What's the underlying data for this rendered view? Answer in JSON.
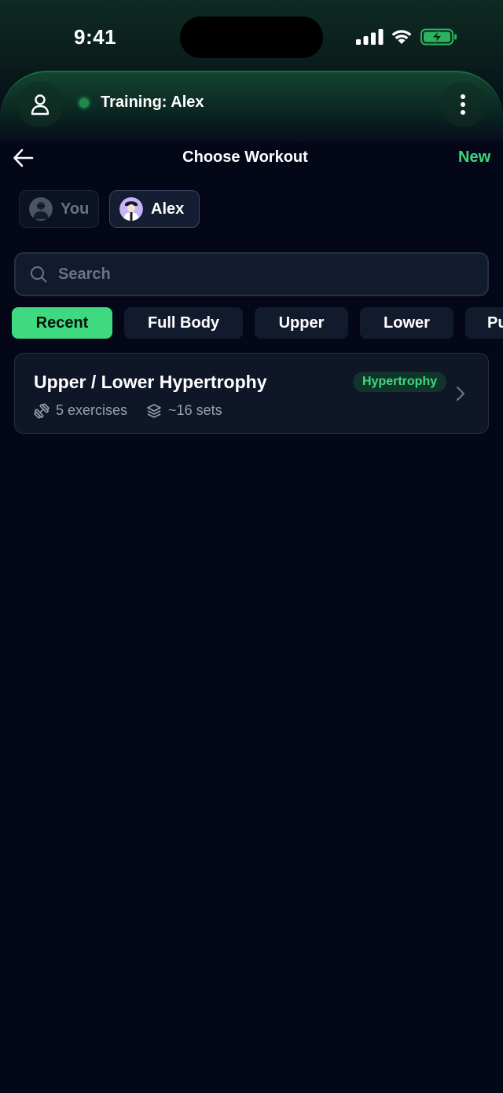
{
  "status_bar": {
    "time": "9:41"
  },
  "header": {
    "training_label": "Training: Alex",
    "status_color": "#22c55e"
  },
  "nav": {
    "title": "Choose Workout",
    "new_label": "New"
  },
  "people": [
    {
      "label": "You",
      "selected": false
    },
    {
      "label": "Alex",
      "selected": true
    }
  ],
  "search": {
    "placeholder": "Search",
    "value": ""
  },
  "filters": [
    {
      "label": "Recent",
      "active": true
    },
    {
      "label": "Full Body",
      "active": false
    },
    {
      "label": "Upper",
      "active": false
    },
    {
      "label": "Lower",
      "active": false
    },
    {
      "label": "Push",
      "active": false
    }
  ],
  "workouts": [
    {
      "title": "Upper / Lower Hypertrophy",
      "tag": "Hypertrophy",
      "exercises": "5 exercises",
      "sets": "~16 sets"
    }
  ],
  "colors": {
    "background": "#030717",
    "accent": "#3fd97f",
    "card": "#0e1627",
    "muted_text": "#9aa1ad"
  },
  "icons": {
    "profile": "person-icon",
    "more": "vertical-dots-icon",
    "back": "arrow-left-icon",
    "search": "magnifier-icon",
    "exercises": "dumbbell-icon",
    "sets": "layers-icon",
    "open": "chevron-right-icon"
  }
}
